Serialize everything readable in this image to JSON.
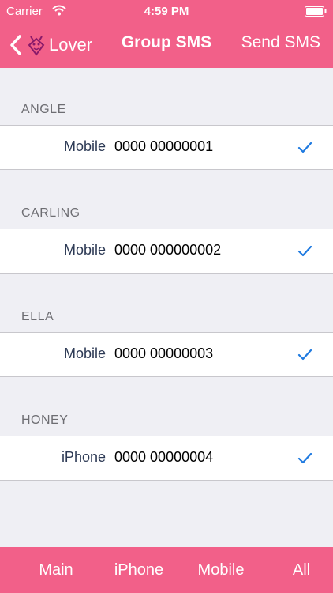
{
  "status": {
    "carrier": "Carrier",
    "time": "4:59 PM"
  },
  "nav": {
    "back_label": "Lover",
    "title": "Group SMS",
    "send_label": "Send SMS"
  },
  "contacts": [
    {
      "name": "ANGLE",
      "label": "Mobile",
      "number": "0000 00000001",
      "checked": true
    },
    {
      "name": "CARLING",
      "label": "Mobile",
      "number": "0000 000000002",
      "checked": true
    },
    {
      "name": "ELLA",
      "label": "Mobile",
      "number": "0000 00000003",
      "checked": true
    },
    {
      "name": "HONEY",
      "label": "iPhone",
      "number": "0000 00000004",
      "checked": true
    }
  ],
  "tabs": [
    "Main",
    "iPhone",
    "Mobile",
    "All"
  ],
  "colors": {
    "accent": "#f26089",
    "check": "#1f7ae0",
    "background": "#efeff4"
  }
}
